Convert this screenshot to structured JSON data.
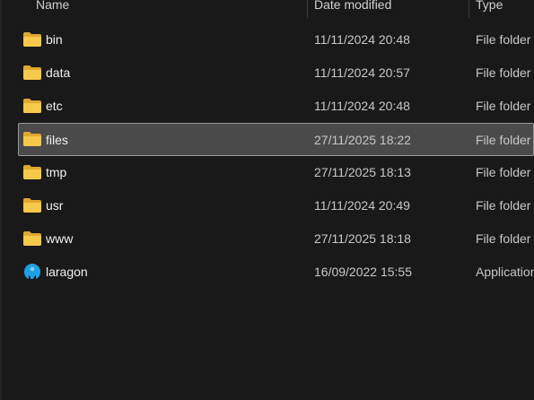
{
  "columns": {
    "name": "Name",
    "date_modified": "Date modified",
    "type": "Type"
  },
  "colors": {
    "background": "#191919",
    "selected_row": "#4a4a4a",
    "selected_border": "#9a9a9a",
    "folder_yellow": "#f5c542",
    "app_blue": "#1ea1e3"
  },
  "rows": [
    {
      "name": "bin",
      "date": "11/11/2024 20:48",
      "type": "File folder",
      "icon": "folder-icon"
    },
    {
      "name": "data",
      "date": "11/11/2024 20:57",
      "type": "File folder",
      "icon": "folder-icon"
    },
    {
      "name": "etc",
      "date": "11/11/2024 20:48",
      "type": "File folder",
      "icon": "folder-icon"
    },
    {
      "name": "files",
      "date": "27/11/2025 18:22",
      "type": "File folder",
      "icon": "folder-icon",
      "selected": true
    },
    {
      "name": "tmp",
      "date": "27/11/2025 18:13",
      "type": "File folder",
      "icon": "folder-icon"
    },
    {
      "name": "usr",
      "date": "11/11/2024 20:49",
      "type": "File folder",
      "icon": "folder-icon"
    },
    {
      "name": "www",
      "date": "27/11/2025 18:18",
      "type": "File folder",
      "icon": "folder-icon"
    },
    {
      "name": "laragon",
      "date": "16/09/2022 15:55",
      "type": "Application",
      "icon": "laragon-app-icon"
    }
  ]
}
